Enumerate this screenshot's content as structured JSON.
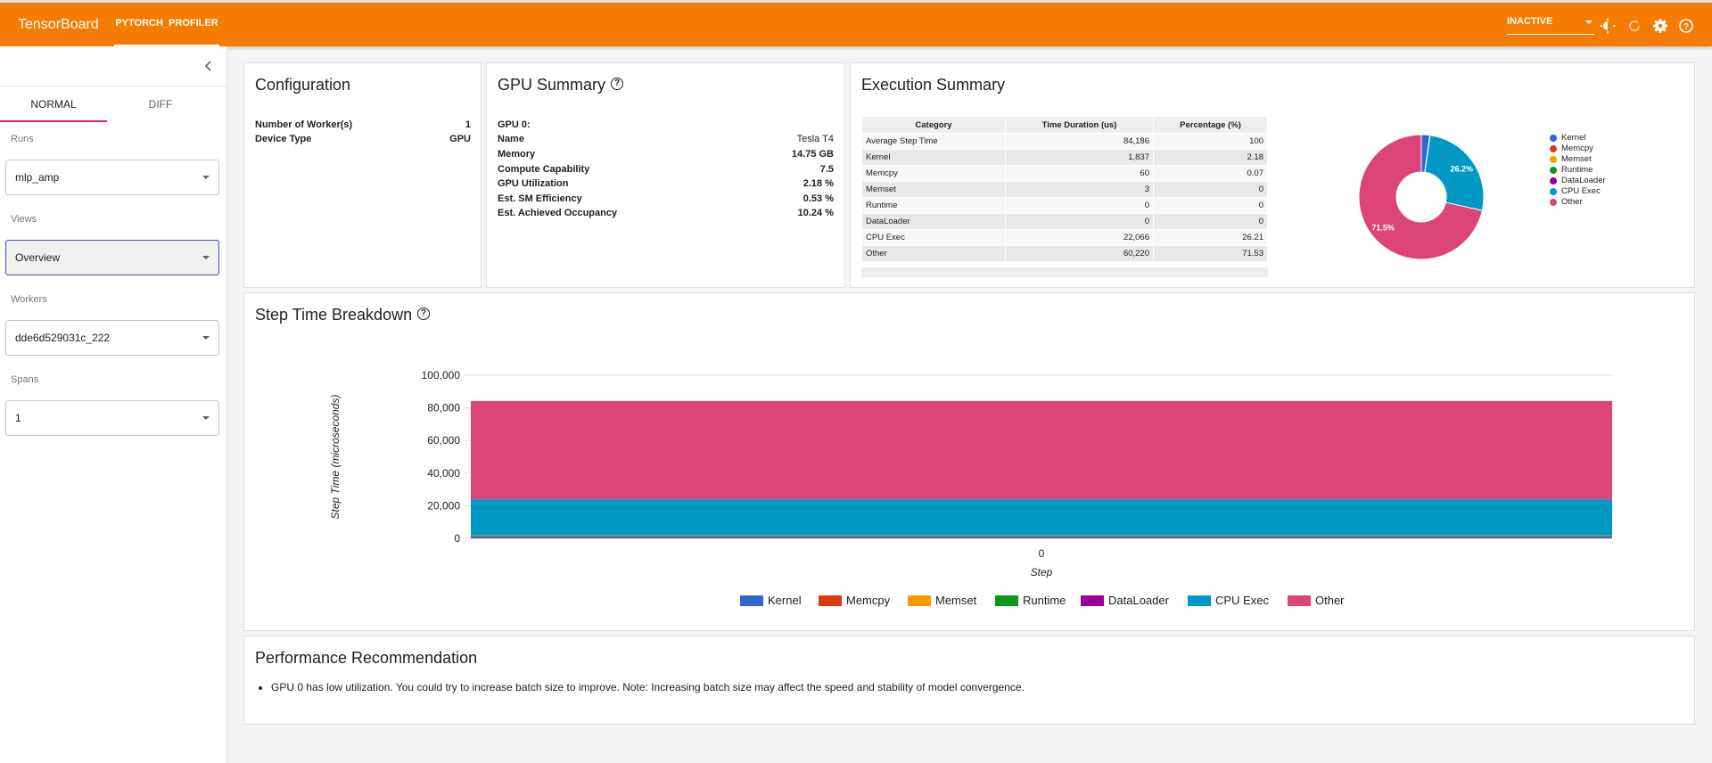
{
  "topbar": {
    "brand": "TensorBoard",
    "active_tab": "PYTORCH_PROFILER",
    "status_select": "INACTIVE"
  },
  "sidebar": {
    "tabs": [
      "NORMAL",
      "DIFF"
    ],
    "runs_label": "Runs",
    "runs_value": "mlp_amp",
    "views_label": "Views",
    "views_value": "Overview",
    "workers_label": "Workers",
    "workers_value": "dde6d529031c_222",
    "spans_label": "Spans",
    "spans_value": "1"
  },
  "configuration": {
    "title": "Configuration",
    "rows": [
      {
        "key": "Number of Worker(s)",
        "value": "1"
      },
      {
        "key": "Device Type",
        "value": "GPU"
      }
    ]
  },
  "gpu_summary": {
    "title": "GPU Summary",
    "gpu_label": "GPU 0:",
    "rows": [
      {
        "key": "Name",
        "value": "Tesla T4"
      },
      {
        "key": "Memory",
        "value": "14.75 GB"
      },
      {
        "key": "Compute Capability",
        "value": "7.5"
      },
      {
        "key": "GPU Utilization",
        "value": "2.18 %"
      },
      {
        "key": "Est. SM Efficiency",
        "value": "0.53 %"
      },
      {
        "key": "Est. Achieved Occupancy",
        "value": "10.24 %"
      }
    ]
  },
  "execution_summary": {
    "title": "Execution Summary",
    "headers": [
      "Category",
      "Time Duration (us)",
      "Percentage (%)"
    ],
    "rows": [
      [
        "Average Step Time",
        "84,186",
        "100"
      ],
      [
        "Kernel",
        "1,837",
        "2.18"
      ],
      [
        "Memcpy",
        "60",
        "0.07"
      ],
      [
        "Memset",
        "3",
        "0"
      ],
      [
        "Runtime",
        "0",
        "0"
      ],
      [
        "DataLoader",
        "0",
        "0"
      ],
      [
        "CPU Exec",
        "22,066",
        "26.21"
      ],
      [
        "Other",
        "60,220",
        "71.53"
      ]
    ],
    "pie_labels": {
      "cpu_exec": "26.2%",
      "other": "71.5%"
    },
    "legend": [
      "Kernel",
      "Memcpy",
      "Memset",
      "Runtime",
      "DataLoader",
      "CPU Exec",
      "Other"
    ]
  },
  "colors": {
    "Kernel": "#3366cc",
    "Memcpy": "#dc3912",
    "Memset": "#ff9900",
    "Runtime": "#109618",
    "DataLoader": "#990099",
    "CPU Exec": "#0099c6",
    "Other": "#dd4477",
    "accent": "#f57c00"
  },
  "step_time": {
    "title": "Step Time Breakdown",
    "y_axis_label": "Step Time (microseconds)",
    "x_axis_label": "Step",
    "x_tick": "0",
    "y_ticks": [
      "100,000",
      "80,000",
      "60,000",
      "40,000",
      "20,000",
      "0"
    ]
  },
  "performance": {
    "title": "Performance Recommendation",
    "items": [
      "GPU 0 has low utilization. You could try to increase batch size to improve. Note: Increasing batch size may affect the speed and stability of model convergence."
    ]
  },
  "chart_data": [
    {
      "type": "pie",
      "title": "",
      "categories": [
        "Kernel",
        "Memcpy",
        "Memset",
        "Runtime",
        "DataLoader",
        "CPU Exec",
        "Other"
      ],
      "values": [
        1837,
        60,
        3,
        0,
        0,
        22066,
        60220
      ],
      "legend_position": "right"
    },
    {
      "type": "area",
      "title": "Step Time Breakdown",
      "xlabel": "Step",
      "ylabel": "Step Time (microseconds)",
      "categories": [
        "0"
      ],
      "ylim": [
        0,
        100000
      ],
      "stacked": true,
      "legend_position": "bottom",
      "series": [
        {
          "name": "Kernel",
          "values": [
            1837
          ]
        },
        {
          "name": "Memcpy",
          "values": [
            60
          ]
        },
        {
          "name": "Memset",
          "values": [
            3
          ]
        },
        {
          "name": "Runtime",
          "values": [
            0
          ]
        },
        {
          "name": "DataLoader",
          "values": [
            0
          ]
        },
        {
          "name": "CPU Exec",
          "values": [
            22066
          ]
        },
        {
          "name": "Other",
          "values": [
            60220
          ]
        }
      ]
    }
  ]
}
